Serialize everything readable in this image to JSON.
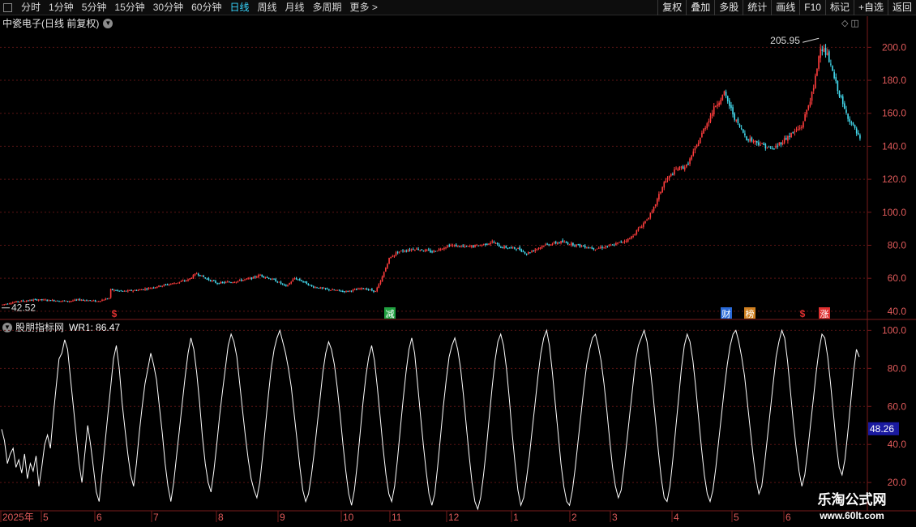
{
  "toolbar": {
    "periods": [
      "分时",
      "1分钟",
      "5分钟",
      "15分钟",
      "30分钟",
      "60分钟",
      "日线",
      "周线",
      "月线",
      "多周期",
      "更多 >"
    ],
    "active_period": "日线",
    "actions": [
      "复权",
      "叠加",
      "多股",
      "统计",
      "画线",
      "F10",
      "标记",
      "+自选",
      "返回"
    ]
  },
  "main_panel": {
    "title": "中瓷电子(日线 前复权)",
    "high_label": "205.95",
    "low_label": "42.52",
    "right_icons": "◇ ◫"
  },
  "indicator_panel": {
    "name": "股朋指标网",
    "wr_label": "WR1:",
    "wr_value": "86.47",
    "current_tag": "48.26"
  },
  "colors": {
    "up": "#ff3d3d",
    "down": "#44dcf0",
    "axis": "#e05a5a",
    "grid": "#5a1414",
    "line": "#ffffff",
    "tag_bg": "#1a1aa0"
  },
  "chart_data": [
    {
      "type": "candlestick",
      "title": "中瓷电子(日线 前复权)",
      "y_ticks": [
        40,
        60,
        80,
        100,
        120,
        140,
        160,
        180,
        200
      ],
      "ylim": [
        36,
        210
      ],
      "grid": true,
      "markers": [
        {
          "label": "$",
          "position_date": "2025-06",
          "color": "#e03030"
        },
        {
          "label": "减",
          "position_date": "2025-11",
          "color": "#20a040"
        },
        {
          "label": "财",
          "position_date": "2026-04",
          "color": "#2a6ad8"
        },
        {
          "label": "榜",
          "position_date": "2026-04",
          "color": "#d08020"
        },
        {
          "label": "$",
          "position_date": "2026-06",
          "color": "#e03030"
        },
        {
          "label": "涨",
          "position_date": "2026-06",
          "color": "#e03030"
        }
      ],
      "series": [
        {
          "anchors": [
            [
              0,
              44
            ],
            [
              4,
              45
            ],
            [
              10,
              46
            ],
            [
              20,
              47
            ],
            [
              30,
              46.5
            ],
            [
              38,
              46
            ],
            [
              45,
              47
            ],
            [
              55,
              46
            ],
            [
              62,
              48
            ],
            [
              63,
              53
            ],
            [
              70,
              52
            ],
            [
              80,
              53
            ],
            [
              90,
              55
            ],
            [
              100,
              57
            ],
            [
              108,
              59
            ],
            [
              113,
              63
            ],
            [
              118,
              60
            ],
            [
              125,
              57
            ],
            [
              135,
              58
            ],
            [
              145,
              60
            ],
            [
              150,
              62
            ],
            [
              155,
              60
            ],
            [
              160,
              58
            ],
            [
              165,
              55
            ],
            [
              170,
              60
            ],
            [
              175,
              58
            ],
            [
              180,
              55
            ],
            [
              190,
              53
            ],
            [
              200,
              52
            ],
            [
              210,
              54
            ],
            [
              217,
              52
            ],
            [
              220,
              58
            ],
            [
              225,
              72
            ],
            [
              230,
              76
            ],
            [
              240,
              78
            ],
            [
              250,
              76
            ],
            [
              260,
              80
            ],
            [
              270,
              79
            ],
            [
              278,
              80
            ],
            [
              285,
              82
            ],
            [
              290,
              79
            ],
            [
              300,
              78
            ],
            [
              305,
              75
            ],
            [
              315,
              80
            ],
            [
              325,
              82
            ],
            [
              335,
              80
            ],
            [
              345,
              78
            ],
            [
              355,
              80
            ],
            [
              365,
              84
            ],
            [
              372,
              92
            ],
            [
              378,
              100
            ],
            [
              385,
              118
            ],
            [
              392,
              126
            ],
            [
              398,
              128
            ],
            [
              403,
              138
            ],
            [
              408,
              150
            ],
            [
              415,
              165
            ],
            [
              420,
              172
            ],
            [
              427,
              155
            ],
            [
              433,
              145
            ],
            [
              440,
              142
            ],
            [
              448,
              138
            ],
            [
              456,
              145
            ],
            [
              465,
              152
            ],
            [
              472,
              175
            ],
            [
              476,
              201
            ],
            [
              480,
              195
            ],
            [
              485,
              178
            ],
            [
              490,
              162
            ],
            [
              496,
              150
            ],
            [
              500,
              142
            ]
          ]
        }
      ]
    },
    {
      "type": "line",
      "title": "WR1",
      "y_ticks": [
        20,
        40,
        60,
        80,
        100
      ],
      "ylim": [
        6,
        104
      ],
      "grid": true,
      "x_tick_labels": [
        "2025年",
        "5",
        "6",
        "7",
        "8",
        "9",
        "10",
        "11",
        "12",
        "1",
        "2",
        "3",
        "4",
        "5",
        "6"
      ],
      "series": [
        {
          "name": "WR1",
          "values": [
            48,
            42,
            30,
            35,
            38,
            28,
            32,
            25,
            35,
            22,
            30,
            26,
            34,
            18,
            28,
            40,
            45,
            38,
            55,
            70,
            85,
            88,
            95,
            90,
            75,
            60,
            45,
            30,
            20,
            35,
            50,
            40,
            28,
            15,
            10,
            25,
            40,
            55,
            70,
            85,
            92,
            80,
            62,
            48,
            35,
            24,
            18,
            30,
            46,
            60,
            72,
            80,
            88,
            82,
            74,
            60,
            46,
            30,
            18,
            10,
            20,
            34,
            48,
            62,
            76,
            88,
            96,
            90,
            78,
            62,
            44,
            30,
            20,
            15,
            26,
            40,
            55,
            68,
            80,
            92,
            98,
            94,
            86,
            72,
            58,
            44,
            32,
            22,
            16,
            12,
            20,
            34,
            50,
            66,
            80,
            90,
            96,
            100,
            94,
            88,
            80,
            70,
            56,
            42,
            28,
            16,
            10,
            14,
            24,
            36,
            50,
            64,
            78,
            88,
            94,
            90,
            82,
            70,
            56,
            40,
            26,
            14,
            8,
            16,
            30,
            46,
            62,
            76,
            86,
            92,
            84,
            70,
            54,
            38,
            24,
            14,
            10,
            18,
            32,
            48,
            64,
            78,
            90,
            96,
            88,
            72,
            56,
            40,
            26,
            14,
            8,
            14,
            28,
            44,
            60,
            74,
            86,
            92,
            96,
            90,
            80,
            66,
            50,
            34,
            20,
            10,
            6,
            12,
            24,
            38,
            54,
            70,
            84,
            94,
            98,
            92,
            80,
            64,
            46,
            30,
            16,
            8,
            12,
            22,
            34,
            48,
            62,
            76,
            88,
            96,
            100,
            92,
            78,
            62,
            46,
            30,
            18,
            10,
            8,
            16,
            28,
            42,
            56,
            70,
            82,
            90,
            96,
            98,
            92,
            84,
            72,
            58,
            42,
            28,
            18,
            12,
            16,
            28,
            42,
            56,
            70,
            84,
            92,
            96,
            100,
            94,
            82,
            68,
            52,
            36,
            22,
            12,
            10,
            18,
            32,
            48,
            64,
            80,
            92,
            98,
            94,
            84,
            70,
            54,
            38,
            24,
            14,
            10,
            16,
            28,
            42,
            56,
            70,
            82,
            92,
            98,
            100,
            94,
            86,
            76,
            62,
            48,
            34,
            22,
            14,
            18,
            30,
            44,
            58,
            72,
            86,
            94,
            100,
            96,
            84,
            68,
            52,
            38,
            26,
            18,
            24,
            36,
            50,
            64,
            78,
            90,
            98,
            96,
            86,
            72,
            56,
            40,
            28,
            24,
            32,
            46,
            62,
            78,
            90,
            86
          ]
        }
      ]
    }
  ],
  "watermark": {
    "title": "乐淘公式网",
    "url": "www.60lt.com"
  }
}
